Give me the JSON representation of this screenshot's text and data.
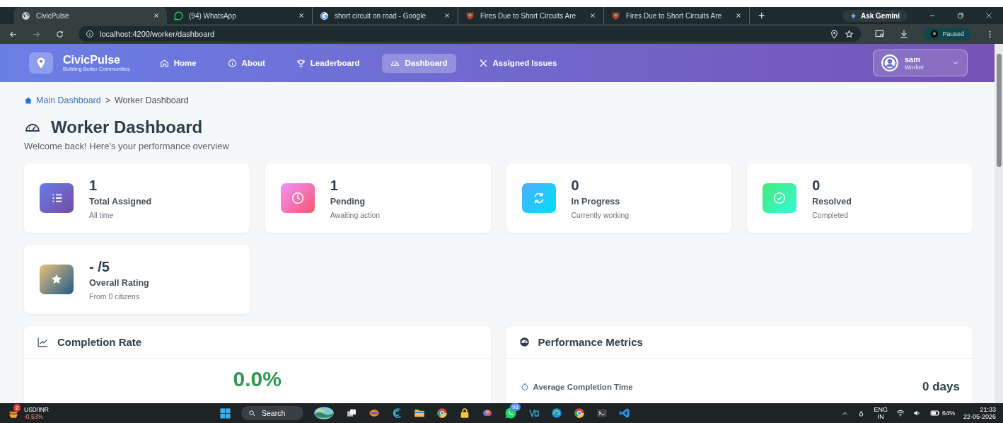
{
  "browser": {
    "tabs": [
      {
        "title": "CivicPulse",
        "selected": true
      },
      {
        "title": "(94) WhatsApp",
        "selected": false
      },
      {
        "title": "short circuit on road - Google",
        "selected": false
      },
      {
        "title": "Fires Due to Short Circuits Are",
        "selected": false
      },
      {
        "title": "Fires Due to Short Circuits Are",
        "selected": false
      }
    ],
    "new_tab": "+",
    "ask": "Ask Gemini",
    "url": "localhost:4200/worker/dashboard",
    "profile": "Paused"
  },
  "nav": {
    "brand": "CivicPulse",
    "tagline": "Building Better Communities",
    "items": [
      {
        "label": "Home",
        "kind": "home",
        "selected": false
      },
      {
        "label": "About",
        "kind": "about",
        "selected": false
      },
      {
        "label": "Leaderboard",
        "kind": "leaderboard",
        "selected": false
      },
      {
        "label": "Dashboard",
        "kind": "dashboard",
        "selected": true
      },
      {
        "label": "Assigned Issues",
        "kind": "issues",
        "selected": false
      }
    ],
    "user": {
      "name": "sam",
      "role": "Worker"
    }
  },
  "breadcrumb": {
    "home": "Main Dashboard",
    "separator": ">",
    "current": "Worker Dashboard"
  },
  "title": "Worker Dashboard",
  "subtitle": "Welcome back! Here's your performance overview",
  "stats": [
    {
      "kind": "total",
      "value": "1",
      "label": "Total Assigned",
      "sub": "All time"
    },
    {
      "kind": "pending",
      "value": "1",
      "label": "Pending",
      "sub": "Awaiting action"
    },
    {
      "kind": "progress",
      "value": "0",
      "label": "In Progress",
      "sub": "Currently working"
    },
    {
      "kind": "resolved",
      "value": "0",
      "label": "Resolved",
      "sub": "Completed"
    },
    {
      "kind": "rating",
      "value": "- /5",
      "label": "Overall Rating",
      "sub": "From 0 citizens"
    }
  ],
  "completion": {
    "title": "Completion Rate",
    "value": "0.0%"
  },
  "metrics": {
    "title": "Performance Metrics",
    "rows": [
      {
        "label": "Average Completion Time",
        "value": "0 days"
      }
    ]
  },
  "taskbar": {
    "widget_badge": "2",
    "widget_title": "USD/INR",
    "widget_change": "-0.53%",
    "search": "Search",
    "chat_badge": "98",
    "lang": "ENG",
    "region": "IN",
    "battery": "64%",
    "time": "21:33",
    "date": "22-05-2026"
  }
}
